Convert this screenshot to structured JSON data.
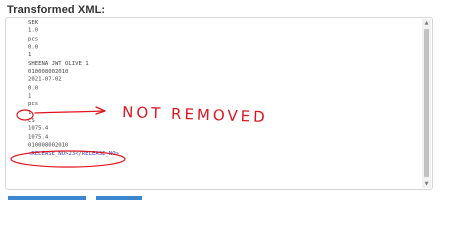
{
  "window": {
    "title": "Transformed XML:"
  },
  "xml_lines": [
    "SEK",
    "1.0",
    "pcs",
    "0.0",
    "1",
    "SHEENA JWT OLIVE 1",
    "010008002010",
    "2021-07-02",
    "0.0",
    "1",
    "pcs",
    "1",
    "CS",
    "1075.4",
    "1075.4",
    "010008002010",
    "<RELEASE_NO>23</RELEASE_NO>"
  ],
  "annotation": {
    "text": "NOT REMOVED",
    "color": "#e0141e"
  },
  "colors": {
    "panel_border": "#d6d6d6",
    "code_text": "#444444",
    "xml_tag_text": "#3a3ac8",
    "scrollbar_thumb": "#c1c1c1",
    "bottom_button": "#3a86d1"
  },
  "icons": {
    "scroll_up": "triangle-up",
    "scroll_down": "triangle-down"
  }
}
